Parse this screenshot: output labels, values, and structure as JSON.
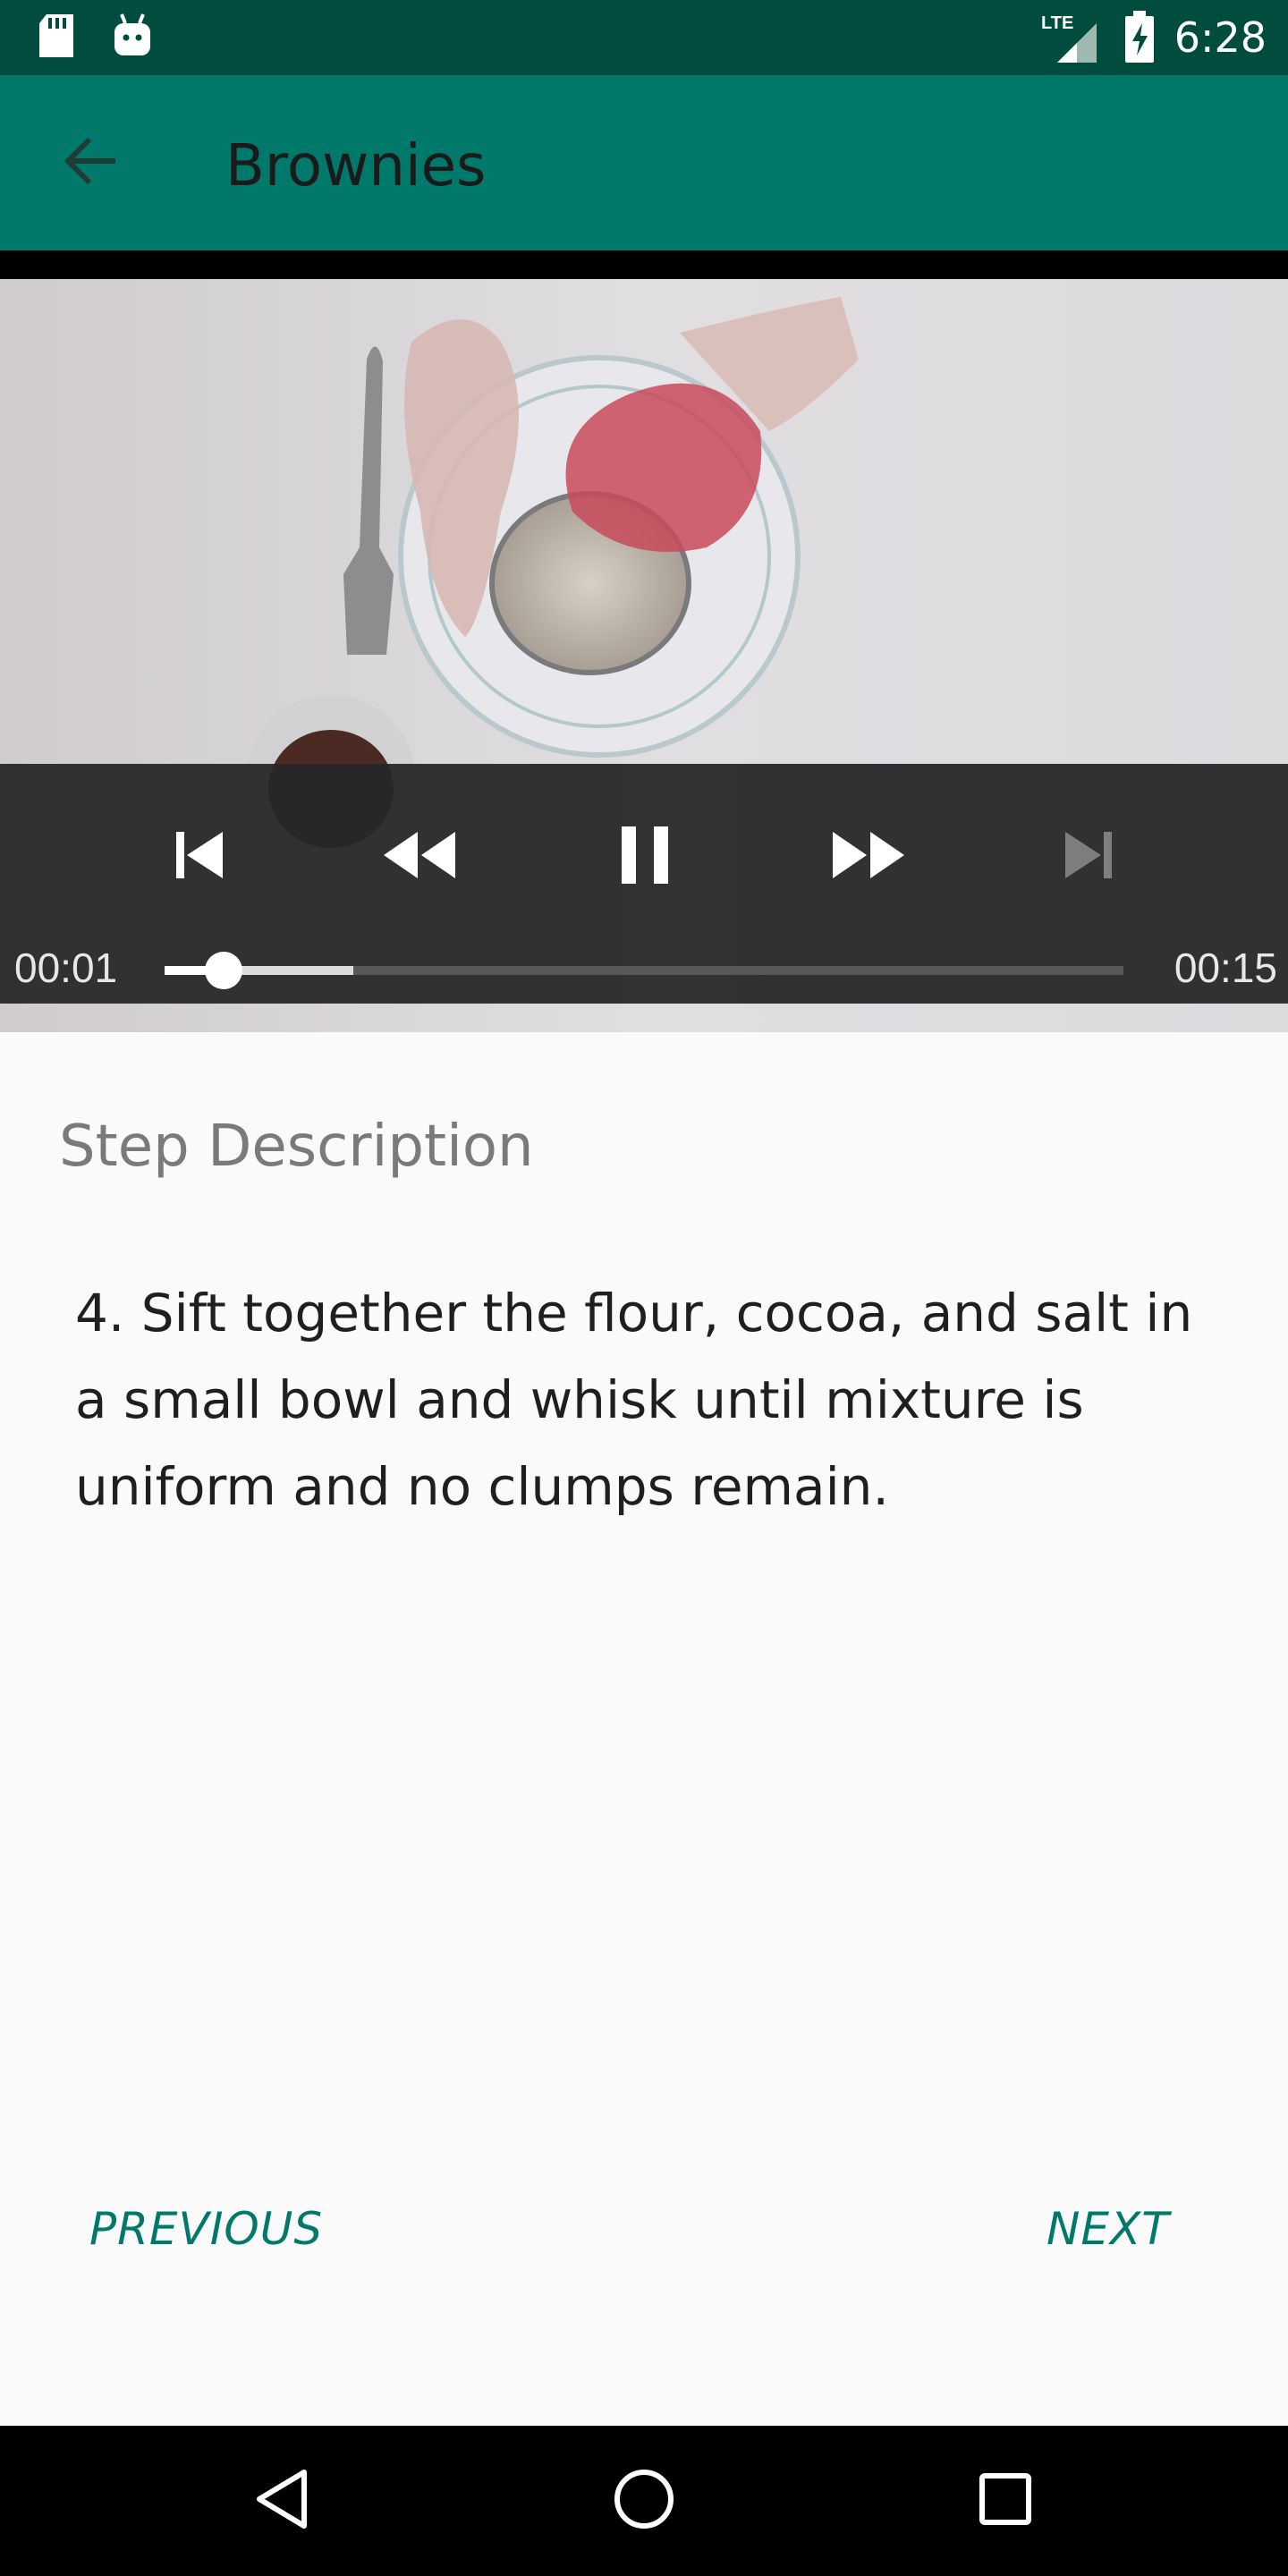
{
  "status_bar": {
    "time": "6:28",
    "network_label": "LTE",
    "icons": [
      "sd-card-icon",
      "android-icon",
      "lte-signal-icon",
      "battery-charging-icon"
    ]
  },
  "app_bar": {
    "title": "Brownies",
    "back_icon": "arrow-back-icon"
  },
  "player": {
    "current_time": "00:01",
    "duration": "00:15",
    "played_fraction": 0.062,
    "buffered_fraction": 0.197,
    "controls": [
      "skip-previous-icon",
      "rewind-icon",
      "pause-icon",
      "fast-forward-icon",
      "skip-next-icon"
    ],
    "skip_next_enabled": false
  },
  "step": {
    "label": "Step Description",
    "description": "4. Sift together the flour, cocoa, and salt in a small bowl and whisk until mixture is uniform and no clumps remain."
  },
  "navigation": {
    "previous_label": "PREVIOUS",
    "next_label": "NEXT"
  },
  "system_nav": [
    "back-triangle-icon",
    "home-circle-icon",
    "recents-square-icon"
  ],
  "colors": {
    "status_bar": "#004d40",
    "app_bar": "#00796b",
    "accent": "#00796b",
    "background": "#fafafa"
  }
}
